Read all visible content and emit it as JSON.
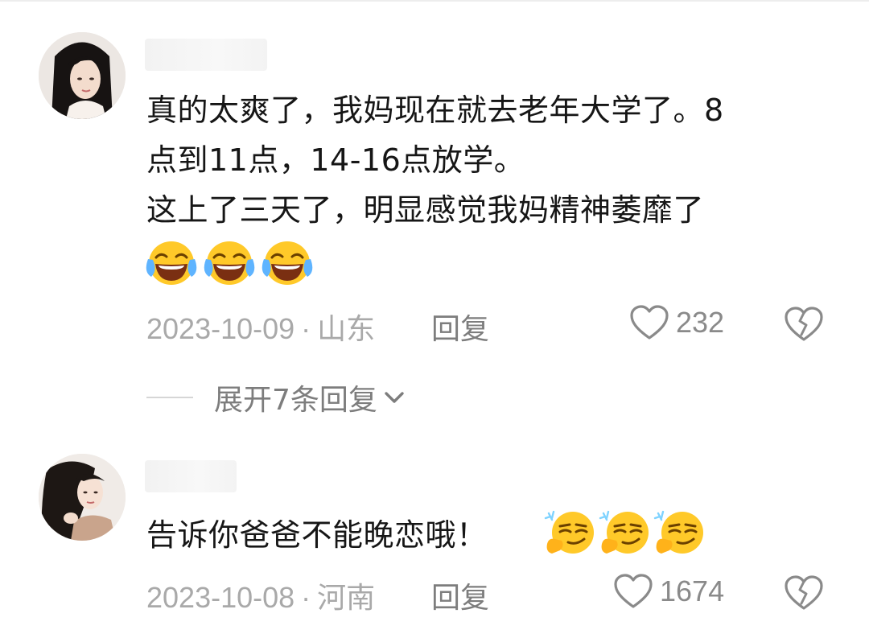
{
  "comments": [
    {
      "lines": [
        "真的太爽了，我妈现在就去老年大学了。8",
        "点到11点，14-16点放学。",
        "这上了三天了，明显感觉我妈精神萎靡了"
      ],
      "emojis": [
        "laugh-cry-emoji",
        "laugh-cry-emoji",
        "laugh-cry-emoji"
      ],
      "date": "2023-10-09",
      "separator": "·",
      "location": "山东",
      "reply_label": "回复",
      "like_count": "232"
    },
    {
      "lines": [
        "告诉你爸爸不能晚恋哦！"
      ],
      "emojis": [
        "smug-emoji",
        "smug-emoji",
        "smug-emoji"
      ],
      "date": "2023-10-08",
      "separator": "·",
      "location": "河南",
      "reply_label": "回复",
      "like_count": "1674"
    }
  ],
  "expand_replies": {
    "label": "展开7条回复",
    "icon": "chevron-down-icon"
  },
  "colors": {
    "meta_gray": "#a9a9a9",
    "icon_gray": "#7d7d7d",
    "text": "#161616"
  }
}
